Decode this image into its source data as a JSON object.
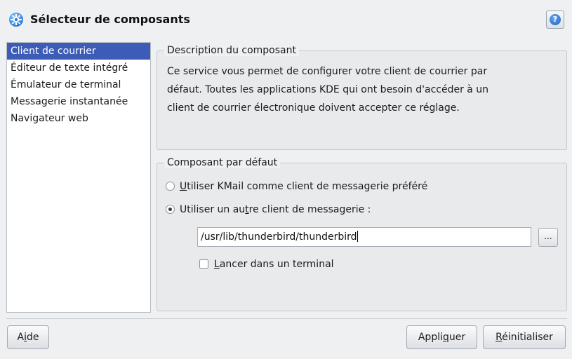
{
  "window": {
    "title": "Sélecteur de composants"
  },
  "sidebar": {
    "items": [
      {
        "label": "Client de courrier",
        "selected": true
      },
      {
        "label": "Éditeur de texte intégré",
        "selected": false
      },
      {
        "label": "Émulateur de terminal",
        "selected": false
      },
      {
        "label": "Messagerie instantanée",
        "selected": false
      },
      {
        "label": "Navigateur web",
        "selected": false
      }
    ]
  },
  "description": {
    "legend": "Description du composant",
    "text_lines": [
      "Ce service vous permet de configurer votre client de courrier par",
      "défaut. Toutes les applications KDE qui ont besoin d'accéder à un",
      "client de courrier électronique doivent accepter ce réglage."
    ]
  },
  "component": {
    "legend": "Composant par défaut",
    "option_kmail": {
      "mnemonic": "U",
      "rest": "tiliser KMail comme client de messagerie préféré",
      "checked": false
    },
    "option_other": {
      "before": "Utiliser un au",
      "mnemonic": "t",
      "after": "re client de messagerie :",
      "checked": true
    },
    "path_value": "/usr/lib/thunderbird/thunderbird",
    "browse_label": "...",
    "terminal": {
      "mnemonic": "L",
      "rest": "ancer dans un terminal",
      "checked": false
    }
  },
  "buttons": {
    "help": {
      "before": "A",
      "mnemonic": "i",
      "after": "de"
    },
    "apply": {
      "before": "Appli",
      "mnemonic": "q",
      "after": "uer"
    },
    "reset": {
      "before": "",
      "mnemonic": "R",
      "after": "éinitialiser"
    }
  },
  "icons": {
    "app": "gear-component-icon",
    "help": "help-question-icon"
  },
  "colors": {
    "selection": "#3d5cb8",
    "background": "#eff0f2",
    "help_icon": "#1b5fc2"
  }
}
